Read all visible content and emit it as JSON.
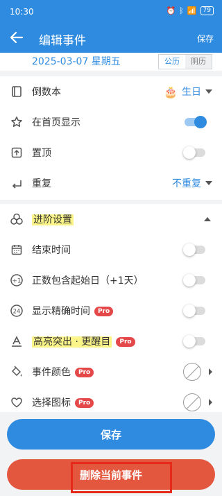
{
  "status": {
    "time": "10:30",
    "battery": "79"
  },
  "app_bar": {
    "title": "编辑事件",
    "save": "保存"
  },
  "date": {
    "text": "2025-03-07 星期五",
    "solar": "公历",
    "lunar": "阴历"
  },
  "rows1": {
    "category": {
      "label": "倒数本",
      "value": "生日"
    },
    "show_home": {
      "label": "在首页显示"
    },
    "pin": {
      "label": "置顶"
    },
    "repeat": {
      "label": "重复",
      "value": "不重复"
    }
  },
  "advanced": {
    "header": "进阶设置",
    "end_time": "结束时间",
    "include_start": "正数包含起始日（+1天）",
    "precise_time": "显示精确时间",
    "highlight": "高亮突出 · 更醒目",
    "event_color": "事件颜色",
    "choose_icon": "选择图标",
    "pro": "Pro"
  },
  "buttons": {
    "save": "保存",
    "delete": "删除当前事件"
  },
  "toggles": {
    "show_home": true,
    "pin": false,
    "end_time": false,
    "include_start": false,
    "precise_time": false,
    "highlight": false
  },
  "colors": {
    "primary": "#2f8be0",
    "danger": "#e4573f",
    "highlight": "#fbf589",
    "frame": "#e62a1a"
  }
}
